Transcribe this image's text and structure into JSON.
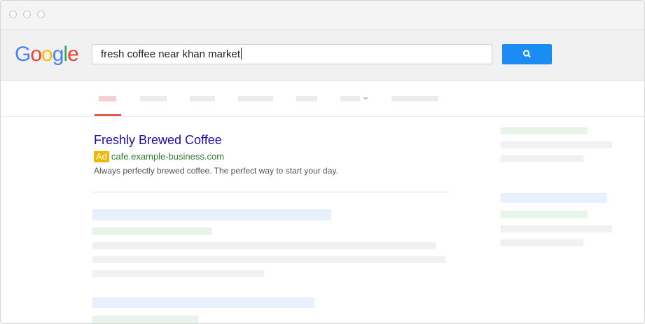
{
  "window": {
    "controls": [
      "close",
      "minimize",
      "maximize"
    ]
  },
  "header": {
    "logo": {
      "letters": [
        "G",
        "o",
        "o",
        "g",
        "l",
        "e"
      ],
      "colors": [
        "#4285f4",
        "#ea4335",
        "#fbbc05",
        "#4285f4",
        "#34a853",
        "#ea4335"
      ]
    },
    "search": {
      "value": "fresh coffee near khan market"
    },
    "search_button": {
      "icon": "search-icon",
      "color": "#1a8cf3"
    }
  },
  "tabs": {
    "active_color": "#e25a4c"
  },
  "results": {
    "ad": {
      "title": "Freshly Brewed Coffee",
      "badge": "Ad",
      "url": "cafe.example-business.com",
      "description": "Always perfectly brewed coffee. The perfect way to start your day."
    }
  },
  "colors": {
    "link": "#1a0dab",
    "url": "#2e7d32",
    "ad_badge": "#f2b705"
  }
}
